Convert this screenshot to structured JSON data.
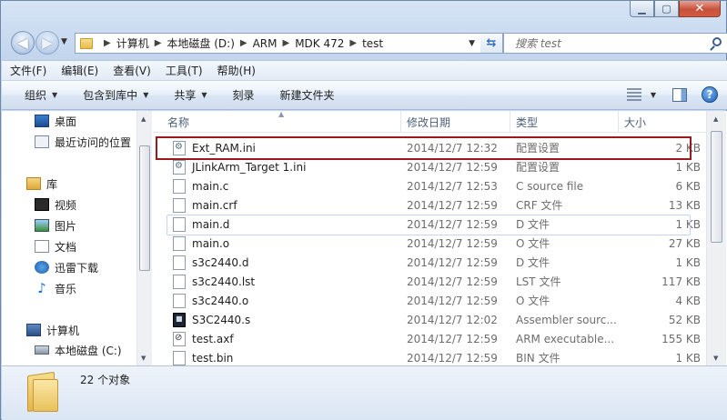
{
  "window": {
    "caption_buttons": [
      "▁",
      "▢",
      "✕"
    ]
  },
  "navigation": {
    "back_glyph": "◀",
    "forward_glyph": "▶",
    "breadcrumbs": [
      "计算机",
      "本地磁盘 (D:)",
      "ARM",
      "MDK 472",
      "test"
    ],
    "refresh_glyph": "⇆",
    "search_placeholder": "搜索 test"
  },
  "menu": [
    "文件(F)",
    "编辑(E)",
    "查看(V)",
    "工具(T)",
    "帮助(H)"
  ],
  "commands": [
    {
      "label": "组织",
      "has_dropdown": true
    },
    {
      "label": "包含到库中",
      "has_dropdown": true
    },
    {
      "label": "共享",
      "has_dropdown": true
    },
    {
      "label": "刻录",
      "has_dropdown": false
    },
    {
      "label": "新建文件夹",
      "has_dropdown": false
    }
  ],
  "help_glyph": "?",
  "sidebar": {
    "favorites": [
      {
        "label": "桌面",
        "icon": "desktop-icon"
      },
      {
        "label": "最近访问的位置",
        "icon": "recent-places-icon"
      }
    ],
    "libraries_label": "库",
    "libraries": [
      {
        "label": "视频",
        "icon": "video-icon"
      },
      {
        "label": "图片",
        "icon": "picture-icon"
      },
      {
        "label": "文档",
        "icon": "document-icon"
      },
      {
        "label": "迅雷下载",
        "icon": "download-icon"
      },
      {
        "label": "音乐",
        "icon": "music-icon"
      }
    ],
    "computer_label": "计算机",
    "drives": [
      {
        "label": "本地磁盘 (C:)",
        "icon": "disk-icon"
      }
    ]
  },
  "columns": {
    "name": "名称",
    "date": "修改日期",
    "type": "类型",
    "size": "大小"
  },
  "files": [
    {
      "name": "Ext_RAM.ini",
      "date": "2014/12/7 12:32",
      "type": "配置设置",
      "size": "2 KB",
      "icon": "config-file-icon"
    },
    {
      "name": "JLinkArm_Target 1.ini",
      "date": "2014/12/7 12:59",
      "type": "配置设置",
      "size": "1 KB",
      "icon": "config-file-icon"
    },
    {
      "name": "main.c",
      "date": "2014/12/7 12:53",
      "type": "C source file",
      "size": "6 KB",
      "icon": "file-icon"
    },
    {
      "name": "main.crf",
      "date": "2014/12/7 12:59",
      "type": "CRF 文件",
      "size": "13 KB",
      "icon": "file-icon"
    },
    {
      "name": "main.d",
      "date": "2014/12/7 12:59",
      "type": "D 文件",
      "size": "1 KB",
      "icon": "file-icon"
    },
    {
      "name": "main.o",
      "date": "2014/12/7 12:59",
      "type": "O 文件",
      "size": "27 KB",
      "icon": "file-icon"
    },
    {
      "name": "s3c2440.d",
      "date": "2014/12/7 12:59",
      "type": "D 文件",
      "size": "1 KB",
      "icon": "file-icon"
    },
    {
      "name": "s3c2440.lst",
      "date": "2014/12/7 12:59",
      "type": "LST 文件",
      "size": "117 KB",
      "icon": "file-icon"
    },
    {
      "name": "s3c2440.o",
      "date": "2014/12/7 12:59",
      "type": "O 文件",
      "size": "4 KB",
      "icon": "file-icon"
    },
    {
      "name": "S3C2440.s",
      "date": "2014/12/7 12:02",
      "type": "Assembler sourc...",
      "size": "52 KB",
      "icon": "assembler-file-icon"
    },
    {
      "name": "test.axf",
      "date": "2014/12/7 12:59",
      "type": "ARM executable...",
      "size": "155 KB",
      "icon": "executable-file-icon"
    },
    {
      "name": "test.bin",
      "date": "2014/12/7 12:59",
      "type": "BIN 文件",
      "size": "1 KB",
      "icon": "file-icon"
    }
  ],
  "status": {
    "item_count": "22 个对象"
  },
  "colors": {
    "highlight_border": "#9a1a1a",
    "accent": "#1d5fb4"
  }
}
